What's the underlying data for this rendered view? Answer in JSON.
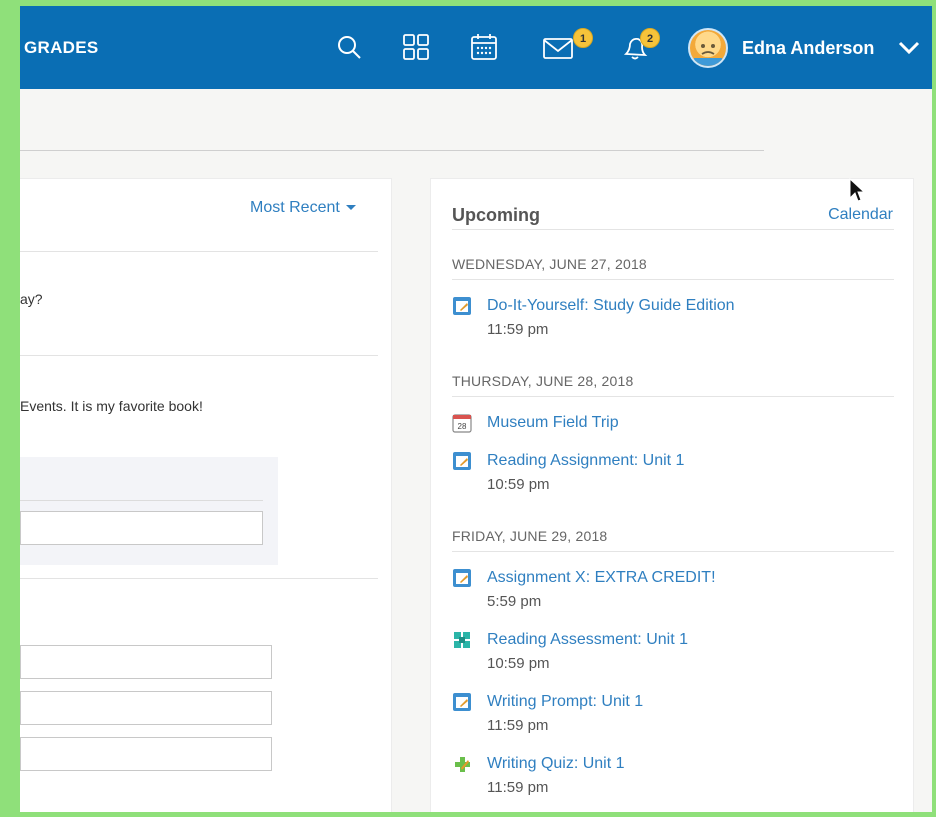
{
  "header": {
    "nav_label": "GRADES",
    "messages_count": "1",
    "notifications_count": "2",
    "user_name": "Edna Anderson"
  },
  "feed": {
    "sort_label": "Most Recent",
    "post1_text": "ay?",
    "post2_text": "Events. It is my favorite book!"
  },
  "upcoming": {
    "title": "Upcoming",
    "calendar_link": "Calendar",
    "days": [
      {
        "date": "WEDNESDAY, JUNE 27, 2018",
        "events": [
          {
            "icon": "assignment-icon",
            "title": "Do-It-Yourself: Study Guide Edition",
            "time": "11:59 pm"
          }
        ]
      },
      {
        "date": "THURSDAY, JUNE 28, 2018",
        "events": [
          {
            "icon": "calendar-event-icon",
            "icon_text": "28",
            "title": "Museum Field Trip",
            "time": ""
          },
          {
            "icon": "assignment-icon",
            "title": "Reading Assignment: Unit 1",
            "time": "10:59 pm"
          }
        ]
      },
      {
        "date": "FRIDAY, JUNE 29, 2018",
        "events": [
          {
            "icon": "assignment-icon",
            "title": "Assignment X: EXTRA CREDIT!",
            "time": "5:59 pm"
          },
          {
            "icon": "assessment-icon",
            "title": "Reading Assessment: Unit 1",
            "time": "10:59 pm"
          },
          {
            "icon": "assignment-icon",
            "title": "Writing Prompt: Unit 1",
            "time": "11:59 pm"
          },
          {
            "icon": "quiz-icon",
            "title": "Writing Quiz: Unit 1",
            "time": "11:59 pm"
          }
        ]
      }
    ]
  },
  "colors": {
    "header_bg": "#0a6eb4",
    "link": "#2f7fc0",
    "badge": "#f6c33a",
    "frame_border": "#8fe07a"
  }
}
